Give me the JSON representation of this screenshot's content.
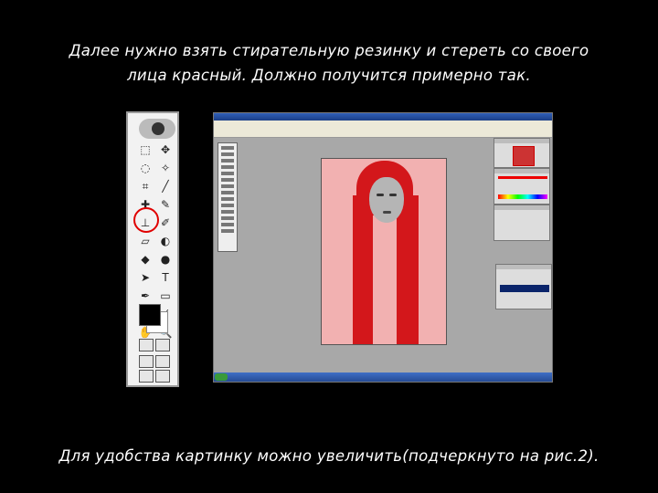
{
  "captions": {
    "top_line1": "Далее нужно взять стирательную резинку и стереть со своего",
    "top_line2": "лица красный. Должно получится примерно так.",
    "bottom": "Для удобства картинку можно увеличить(подчеркнуто на рис.2)."
  },
  "toolbox": {
    "tools": [
      {
        "icon": "marquee-icon",
        "glyph": "⬚"
      },
      {
        "icon": "move-icon",
        "glyph": "✥"
      },
      {
        "icon": "lasso-icon",
        "glyph": "◌"
      },
      {
        "icon": "magic-wand-icon",
        "glyph": "✧"
      },
      {
        "icon": "crop-icon",
        "glyph": "⌗"
      },
      {
        "icon": "slice-icon",
        "glyph": "╱"
      },
      {
        "icon": "healing-brush-icon",
        "glyph": "✚"
      },
      {
        "icon": "brush-icon",
        "glyph": "✎"
      },
      {
        "icon": "clone-stamp-icon",
        "glyph": "⊥"
      },
      {
        "icon": "history-brush-icon",
        "glyph": "✐"
      },
      {
        "icon": "eraser-icon",
        "glyph": "▱"
      },
      {
        "icon": "gradient-icon",
        "glyph": "◐"
      },
      {
        "icon": "blur-icon",
        "glyph": "◆"
      },
      {
        "icon": "dodge-icon",
        "glyph": "●"
      },
      {
        "icon": "path-selection-icon",
        "glyph": "➤"
      },
      {
        "icon": "type-icon",
        "glyph": "T"
      },
      {
        "icon": "pen-icon",
        "glyph": "✒"
      },
      {
        "icon": "shape-icon",
        "glyph": "▭"
      },
      {
        "icon": "notes-icon",
        "glyph": "▢"
      },
      {
        "icon": "eyedropper-icon",
        "glyph": "⁄"
      },
      {
        "icon": "hand-icon",
        "glyph": "✋"
      },
      {
        "icon": "zoom-icon",
        "glyph": "🔍"
      }
    ],
    "highlighted_tool": "eraser-icon",
    "highlight_color": "#e00000",
    "foreground_color": "#000000",
    "background_color": "#ffffff"
  },
  "photo": {
    "background_color": "#f2b1b1",
    "hair_color": "#d3171b"
  }
}
